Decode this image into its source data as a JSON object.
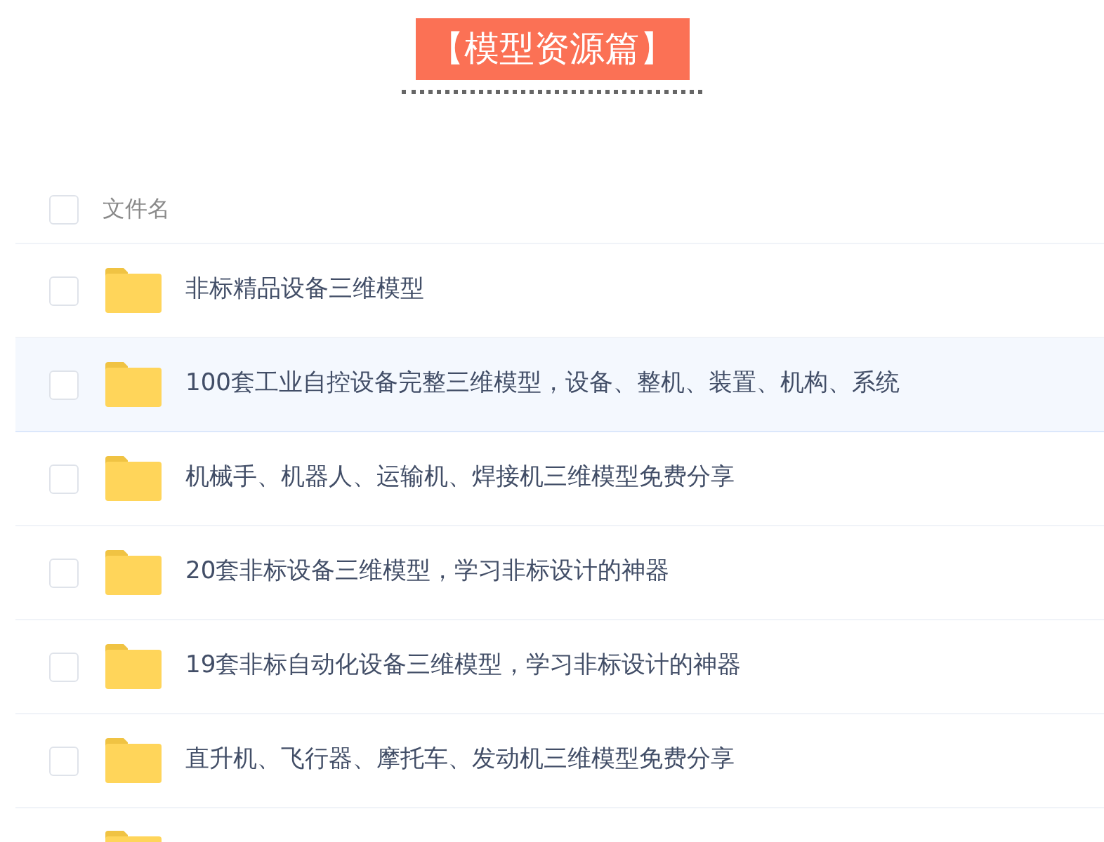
{
  "title": "【模型资源篇】",
  "table": {
    "header": {
      "label": "文件名",
      "checked": false
    },
    "rows": [
      {
        "kind": "folder",
        "name": "非标精品设备三维模型",
        "checked": false,
        "selected": false
      },
      {
        "kind": "folder",
        "name": "100套工业自控设备完整三维模型，设备、整机、装置、机构、系统",
        "checked": false,
        "selected": true
      },
      {
        "kind": "folder",
        "name": "机械手、机器人、运输机、焊接机三维模型免费分享",
        "checked": false,
        "selected": false
      },
      {
        "kind": "folder",
        "name": "20套非标设备三维模型，学习非标设计的神器",
        "checked": false,
        "selected": false
      },
      {
        "kind": "folder",
        "name": "19套非标自动化设备三维模型，学习非标设计的神器",
        "checked": false,
        "selected": false
      },
      {
        "kind": "folder",
        "name": "直升机、飞行器、摩托车、发动机三维模型免费分享",
        "checked": false,
        "selected": false
      },
      {
        "kind": "folder-peek"
      }
    ]
  }
}
